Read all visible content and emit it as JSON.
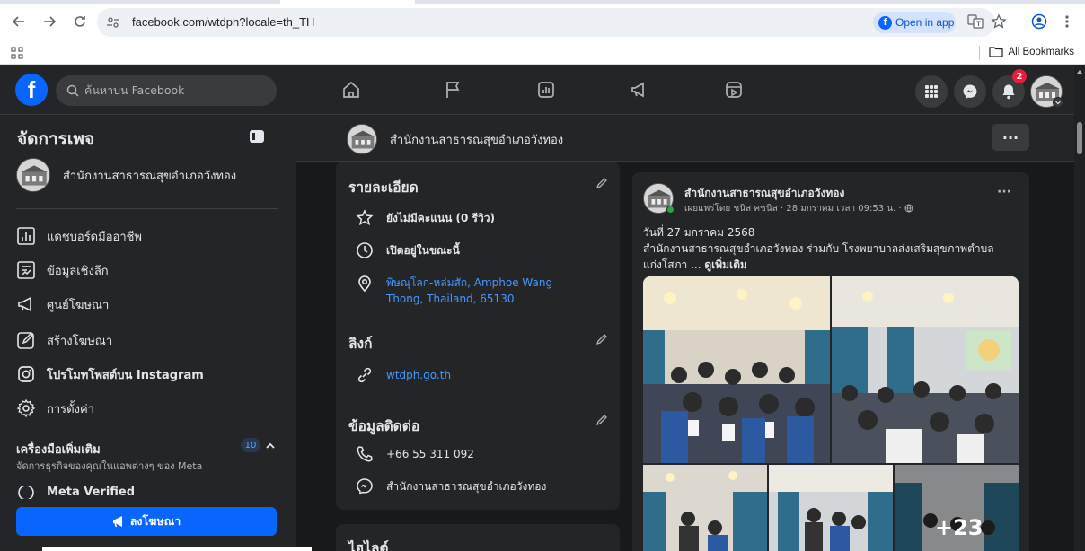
{
  "browser": {
    "url": "facebook.com/wtdph?locale=th_TH",
    "open_in_app": "Open in app",
    "all_bookmarks": "All Bookmarks"
  },
  "fb_header": {
    "logo": "f",
    "search_placeholder": "ค้นหาบน Facebook",
    "notification_count": "2"
  },
  "sidebar": {
    "title": "จัดการเพจ",
    "page_name": "สำนักงานสาธารณสุขอำเภอวังทอง",
    "items": [
      {
        "label": "แดชบอร์ดมืออาชีพ",
        "icon": "dashboard-icon"
      },
      {
        "label": "ข้อมูลเชิงลึก",
        "icon": "insights-icon"
      },
      {
        "label": "ศูนย์โฆษณา",
        "icon": "megaphone-icon"
      },
      {
        "label": "สร้างโฆษณา",
        "icon": "edit-icon"
      },
      {
        "label": "โปรโมทโพสต์บน Instagram",
        "icon": "instagram-icon"
      },
      {
        "label": "การตั้งค่า",
        "icon": "gear-icon"
      }
    ],
    "tools_title": "เครื่องมือเพิ่มเติม",
    "tools_subtitle": "จัดการธุรกิจของคุณในแอพต่างๆ ของ Meta",
    "tools_count": "10",
    "meta_verified": "Meta Verified",
    "promote_button": "ลงโฆษณา"
  },
  "page_header": {
    "name": "สำนักงานสาธารณสุขอำเภอวังทอง",
    "more": "···"
  },
  "details": {
    "title": "รายละเอียด",
    "rating": "ยังไม่มีคะแนน (0 รีวิว)",
    "hours": "เปิดอยู่ในขณะนี้",
    "address_line1": "พิษณุโลก-หล่มสัก, Amphoe Wang",
    "address_line2": "Thong, Thailand, 65130",
    "links_title": "ลิงก์",
    "website": "wtdph.go.th",
    "contact_title": "ข้อมูลติดต่อ",
    "phone": "+66 55 311 092",
    "messenger": "สำนักงานสาธารณสุขอำเภอวังทอง",
    "highlights_title": "ไฮไลต์"
  },
  "post": {
    "author": "สำนักงานสาธารณสุขอำเภอวังทอง",
    "meta": "เผยแพร่โดย ชนิส คชนิล  · 28 มกราคม เวลา 09:53 น. ·",
    "more": "···",
    "line1": "วันที่ 27 มกราคม 2568",
    "line2": "สำนักงานสาธารณสุขอำเภอวังทอง ร่วมกับ โรงพยาบาลส่งเสริมสุขภาพตำบล",
    "line3": "แก่งโสภา ...",
    "see_more": "ดูเพิ่มเติม",
    "extra_photos": "+23"
  }
}
